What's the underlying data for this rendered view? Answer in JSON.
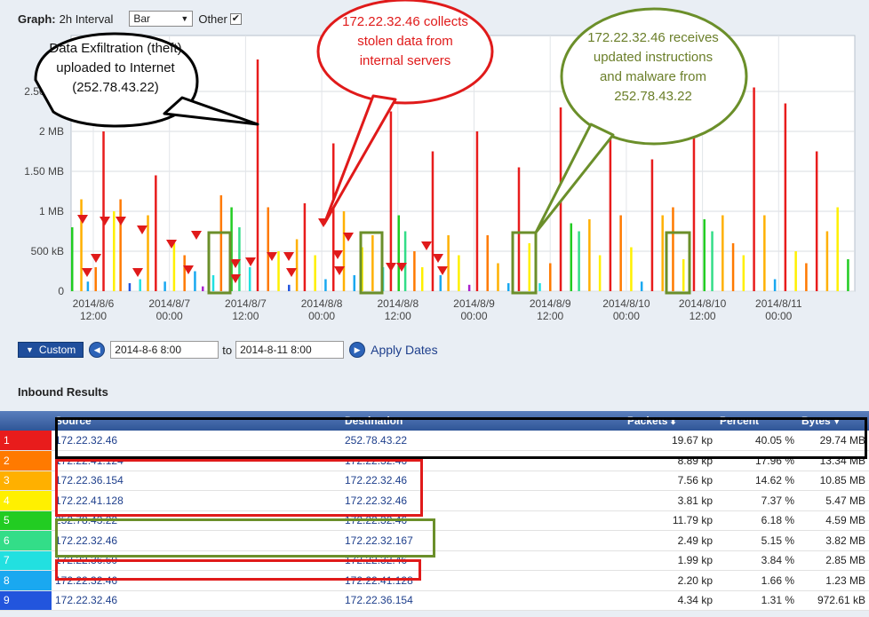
{
  "graph": {
    "label": "Graph:",
    "interval": "2h Interval",
    "chart_type": "Bar",
    "other_label": "Other",
    "other_checked": "✔"
  },
  "chart_data": {
    "type": "bar",
    "y_ticks": [
      "0",
      "500 kB",
      "1 MB",
      "1.50 MB",
      "2 MB",
      "2.50 MB"
    ],
    "ylim": [
      0,
      3.2
    ],
    "x_ticks": [
      {
        "date": "2014/8/6",
        "time": "12:00"
      },
      {
        "date": "2014/8/7",
        "time": "00:00"
      },
      {
        "date": "2014/8/7",
        "time": "12:00"
      },
      {
        "date": "2014/8/8",
        "time": "00:00"
      },
      {
        "date": "2014/8/8",
        "time": "12:00"
      },
      {
        "date": "2014/8/9",
        "time": "00:00"
      },
      {
        "date": "2014/8/9",
        "time": "12:00"
      },
      {
        "date": "2014/8/10",
        "time": "00:00"
      },
      {
        "date": "2014/8/10",
        "time": "12:00"
      },
      {
        "date": "2014/8/11",
        "time": "00:00"
      }
    ],
    "series_colors": [
      "#e81c1c",
      "#ff7a00",
      "#ffb000",
      "#fff000",
      "#22cc22",
      "#33dd88",
      "#22e0e0",
      "#1aa8f0",
      "#2255dd",
      "#aa22cc"
    ],
    "bars": [
      {
        "t": 0.0,
        "c": 4,
        "v": 0.8
      },
      {
        "t": 0.35,
        "c": 2,
        "v": 1.15
      },
      {
        "t": 0.6,
        "c": 7,
        "v": 0.12
      },
      {
        "t": 0.9,
        "c": 1,
        "v": 0.3
      },
      {
        "t": 1.2,
        "c": 0,
        "v": 2.0
      },
      {
        "t": 1.6,
        "c": 3,
        "v": 1.0
      },
      {
        "t": 1.85,
        "c": 1,
        "v": 1.15
      },
      {
        "t": 2.2,
        "c": 8,
        "v": 0.1
      },
      {
        "t": 2.6,
        "c": 6,
        "v": 0.15
      },
      {
        "t": 2.9,
        "c": 2,
        "v": 0.95
      },
      {
        "t": 3.2,
        "c": 0,
        "v": 1.45
      },
      {
        "t": 3.55,
        "c": 7,
        "v": 0.12
      },
      {
        "t": 3.9,
        "c": 3,
        "v": 0.6
      },
      {
        "t": 4.3,
        "c": 1,
        "v": 0.45
      },
      {
        "t": 4.7,
        "c": 7,
        "v": 0.25
      },
      {
        "t": 5.0,
        "c": 9,
        "v": 0.06
      },
      {
        "t": 5.4,
        "c": 6,
        "v": 0.2
      },
      {
        "t": 5.7,
        "c": 1,
        "v": 1.2
      },
      {
        "t": 6.1,
        "c": 4,
        "v": 1.05
      },
      {
        "t": 6.4,
        "c": 5,
        "v": 0.8
      },
      {
        "t": 6.8,
        "c": 6,
        "v": 0.3
      },
      {
        "t": 7.1,
        "c": 0,
        "v": 2.9
      },
      {
        "t": 7.5,
        "c": 1,
        "v": 1.05
      },
      {
        "t": 7.9,
        "c": 3,
        "v": 0.5
      },
      {
        "t": 8.3,
        "c": 8,
        "v": 0.08
      },
      {
        "t": 8.6,
        "c": 2,
        "v": 0.65
      },
      {
        "t": 8.9,
        "c": 0,
        "v": 1.1
      },
      {
        "t": 9.3,
        "c": 3,
        "v": 0.45
      },
      {
        "t": 9.7,
        "c": 7,
        "v": 0.15
      },
      {
        "t": 10.0,
        "c": 0,
        "v": 1.85
      },
      {
        "t": 10.4,
        "c": 2,
        "v": 1.0
      },
      {
        "t": 10.8,
        "c": 7,
        "v": 0.2
      },
      {
        "t": 11.1,
        "c": 3,
        "v": 0.55
      },
      {
        "t": 11.5,
        "c": 2,
        "v": 0.7
      },
      {
        "t": 11.9,
        "c": 6,
        "v": 0.3
      },
      {
        "t": 12.2,
        "c": 0,
        "v": 2.25
      },
      {
        "t": 12.5,
        "c": 4,
        "v": 0.95
      },
      {
        "t": 12.75,
        "c": 5,
        "v": 0.75
      },
      {
        "t": 13.1,
        "c": 1,
        "v": 0.5
      },
      {
        "t": 13.4,
        "c": 3,
        "v": 0.3
      },
      {
        "t": 13.8,
        "c": 0,
        "v": 1.75
      },
      {
        "t": 14.1,
        "c": 7,
        "v": 0.2
      },
      {
        "t": 14.4,
        "c": 2,
        "v": 0.7
      },
      {
        "t": 14.8,
        "c": 3,
        "v": 0.45
      },
      {
        "t": 15.2,
        "c": 9,
        "v": 0.08
      },
      {
        "t": 15.5,
        "c": 0,
        "v": 2.0
      },
      {
        "t": 15.9,
        "c": 1,
        "v": 0.7
      },
      {
        "t": 16.3,
        "c": 2,
        "v": 0.35
      },
      {
        "t": 16.7,
        "c": 7,
        "v": 0.1
      },
      {
        "t": 17.1,
        "c": 0,
        "v": 1.55
      },
      {
        "t": 17.5,
        "c": 3,
        "v": 0.6
      },
      {
        "t": 17.9,
        "c": 6,
        "v": 0.1
      },
      {
        "t": 18.3,
        "c": 1,
        "v": 0.35
      },
      {
        "t": 18.7,
        "c": 0,
        "v": 2.3
      },
      {
        "t": 19.1,
        "c": 4,
        "v": 0.85
      },
      {
        "t": 19.4,
        "c": 5,
        "v": 0.75
      },
      {
        "t": 19.8,
        "c": 2,
        "v": 0.9
      },
      {
        "t": 20.2,
        "c": 3,
        "v": 0.45
      },
      {
        "t": 20.6,
        "c": 0,
        "v": 2.0
      },
      {
        "t": 21.0,
        "c": 1,
        "v": 0.95
      },
      {
        "t": 21.4,
        "c": 3,
        "v": 0.55
      },
      {
        "t": 21.8,
        "c": 7,
        "v": 0.12
      },
      {
        "t": 22.2,
        "c": 0,
        "v": 1.65
      },
      {
        "t": 22.6,
        "c": 2,
        "v": 0.95
      },
      {
        "t": 23.0,
        "c": 1,
        "v": 1.05
      },
      {
        "t": 23.4,
        "c": 3,
        "v": 0.4
      },
      {
        "t": 23.8,
        "c": 0,
        "v": 2.4
      },
      {
        "t": 24.2,
        "c": 4,
        "v": 0.9
      },
      {
        "t": 24.5,
        "c": 5,
        "v": 0.75
      },
      {
        "t": 24.9,
        "c": 2,
        "v": 0.95
      },
      {
        "t": 25.3,
        "c": 1,
        "v": 0.6
      },
      {
        "t": 25.7,
        "c": 3,
        "v": 0.45
      },
      {
        "t": 26.1,
        "c": 0,
        "v": 2.55
      },
      {
        "t": 26.5,
        "c": 2,
        "v": 0.95
      },
      {
        "t": 26.9,
        "c": 7,
        "v": 0.15
      },
      {
        "t": 27.3,
        "c": 0,
        "v": 2.35
      },
      {
        "t": 27.7,
        "c": 3,
        "v": 0.5
      },
      {
        "t": 28.1,
        "c": 1,
        "v": 0.35
      },
      {
        "t": 28.5,
        "c": 0,
        "v": 1.75
      },
      {
        "t": 28.9,
        "c": 2,
        "v": 0.75
      },
      {
        "t": 29.3,
        "c": 3,
        "v": 1.05
      },
      {
        "t": 29.7,
        "c": 4,
        "v": 0.4
      }
    ]
  },
  "callouts": {
    "exfil": "Data Exfiltration (theft) uploaded to Internet (252.78.43.22)",
    "collect": "172.22.32.46 collects stolen data from internal servers",
    "malware": "172.22.32.46 receives updated instructions and malware from 252.78.43.22"
  },
  "controls": {
    "custom_label": "Custom",
    "start_date": "2014-8-6 8:00",
    "to_label": "to",
    "end_date": "2014-8-11 8:00",
    "apply_label": "Apply Dates"
  },
  "results": {
    "title": "Inbound Results",
    "columns": {
      "source": "Source",
      "destination": "Destination",
      "packets": "Packets",
      "percent": "Percent",
      "bytes": "Bytes"
    },
    "rows": [
      {
        "rank": "1",
        "color": "#e81c1c",
        "source": "172.22.32.46",
        "destination": "252.78.43.22",
        "packets": "19.67 kp",
        "percent": "40.05 %",
        "bytes": "29.74 MB"
      },
      {
        "rank": "2",
        "color": "#ff7a00",
        "source": "172.22.41.124",
        "destination": "172.22.32.46",
        "packets": "8.89 kp",
        "percent": "17.96 %",
        "bytes": "13.34 MB"
      },
      {
        "rank": "3",
        "color": "#ffb000",
        "source": "172.22.36.154",
        "destination": "172.22.32.46",
        "packets": "7.56 kp",
        "percent": "14.62 %",
        "bytes": "10.85 MB"
      },
      {
        "rank": "4",
        "color": "#fff000",
        "source": "172.22.41.128",
        "destination": "172.22.32.46",
        "packets": "3.81 kp",
        "percent": "7.37 %",
        "bytes": "5.47 MB"
      },
      {
        "rank": "5",
        "color": "#22cc22",
        "source": "252.78.43.22",
        "destination": "172.22.32.46",
        "packets": "11.79 kp",
        "percent": "6.18 %",
        "bytes": "4.59 MB"
      },
      {
        "rank": "6",
        "color": "#33dd88",
        "source": "172.22.32.46",
        "destination": "172.22.32.167",
        "packets": "2.49 kp",
        "percent": "5.15 %",
        "bytes": "3.82 MB"
      },
      {
        "rank": "7",
        "color": "#22e0e0",
        "source": "172.22.36.60",
        "destination": "172.22.32.46",
        "packets": "1.99 kp",
        "percent": "3.84 %",
        "bytes": "2.85 MB"
      },
      {
        "rank": "8",
        "color": "#1aa8f0",
        "source": "172.22.32.46",
        "destination": "172.22.41.128",
        "packets": "2.20 kp",
        "percent": "1.66 %",
        "bytes": "1.23 MB"
      },
      {
        "rank": "9",
        "color": "#2255dd",
        "source": "172.22.32.46",
        "destination": "172.22.36.154",
        "packets": "4.34 kp",
        "percent": "1.31 %",
        "bytes": "972.61 kB"
      }
    ]
  },
  "annotation_colors": {
    "black": "#000000",
    "red": "#e01a1a",
    "green": "#6b8f2a"
  }
}
